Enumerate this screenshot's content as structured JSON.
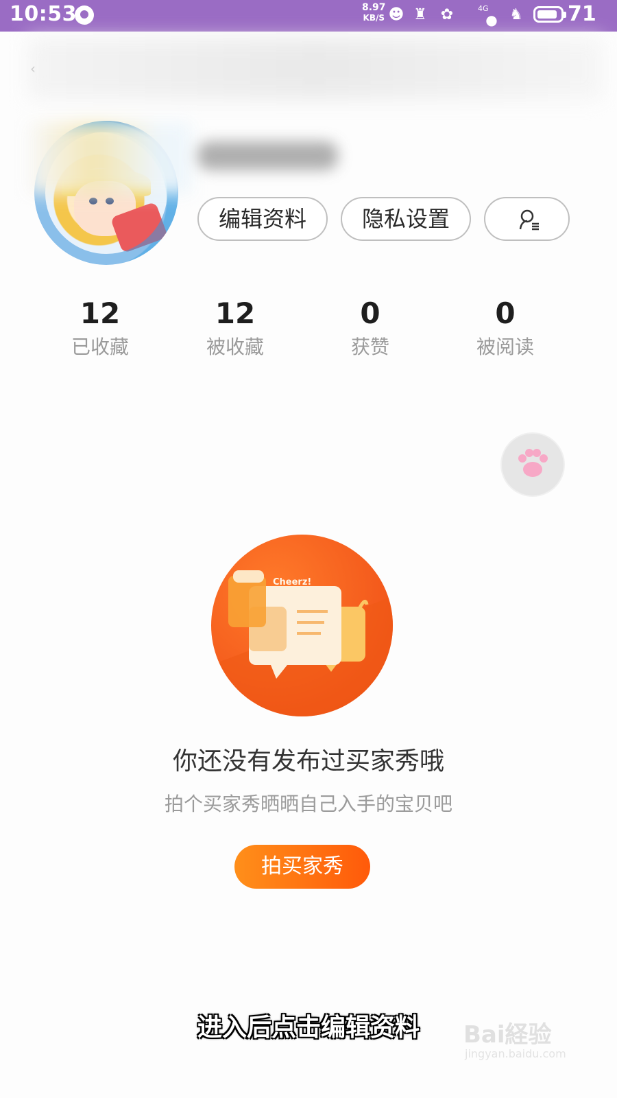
{
  "status_bar": {
    "time": "10:53",
    "net_speed_value": "8.97",
    "net_speed_unit": "KB/S",
    "network": "4G",
    "battery_level": "71"
  },
  "profile": {
    "buttons": {
      "edit_label": "编辑资料",
      "privacy_label": "隐私设置"
    },
    "stats": [
      {
        "value": "12",
        "label": "已收藏"
      },
      {
        "value": "12",
        "label": "被收藏"
      },
      {
        "value": "0",
        "label": "获赞"
      },
      {
        "value": "0",
        "label": "被阅读"
      }
    ]
  },
  "empty_state": {
    "illustration_text": "Cheerz!",
    "title": "你还没有发布过买家秀哦",
    "subtitle": "拍个买家秀晒晒自己入手的宝贝吧",
    "cta_label": "拍买家秀"
  },
  "caption": "进入后点击编辑资料",
  "watermark": {
    "brand": "Bai経验",
    "url": "jingyan.baidu.com"
  },
  "colors": {
    "status_bar": "#9a6cc4",
    "accent_orange": "#ff6a10",
    "paw_pink": "#f7a8c6"
  }
}
